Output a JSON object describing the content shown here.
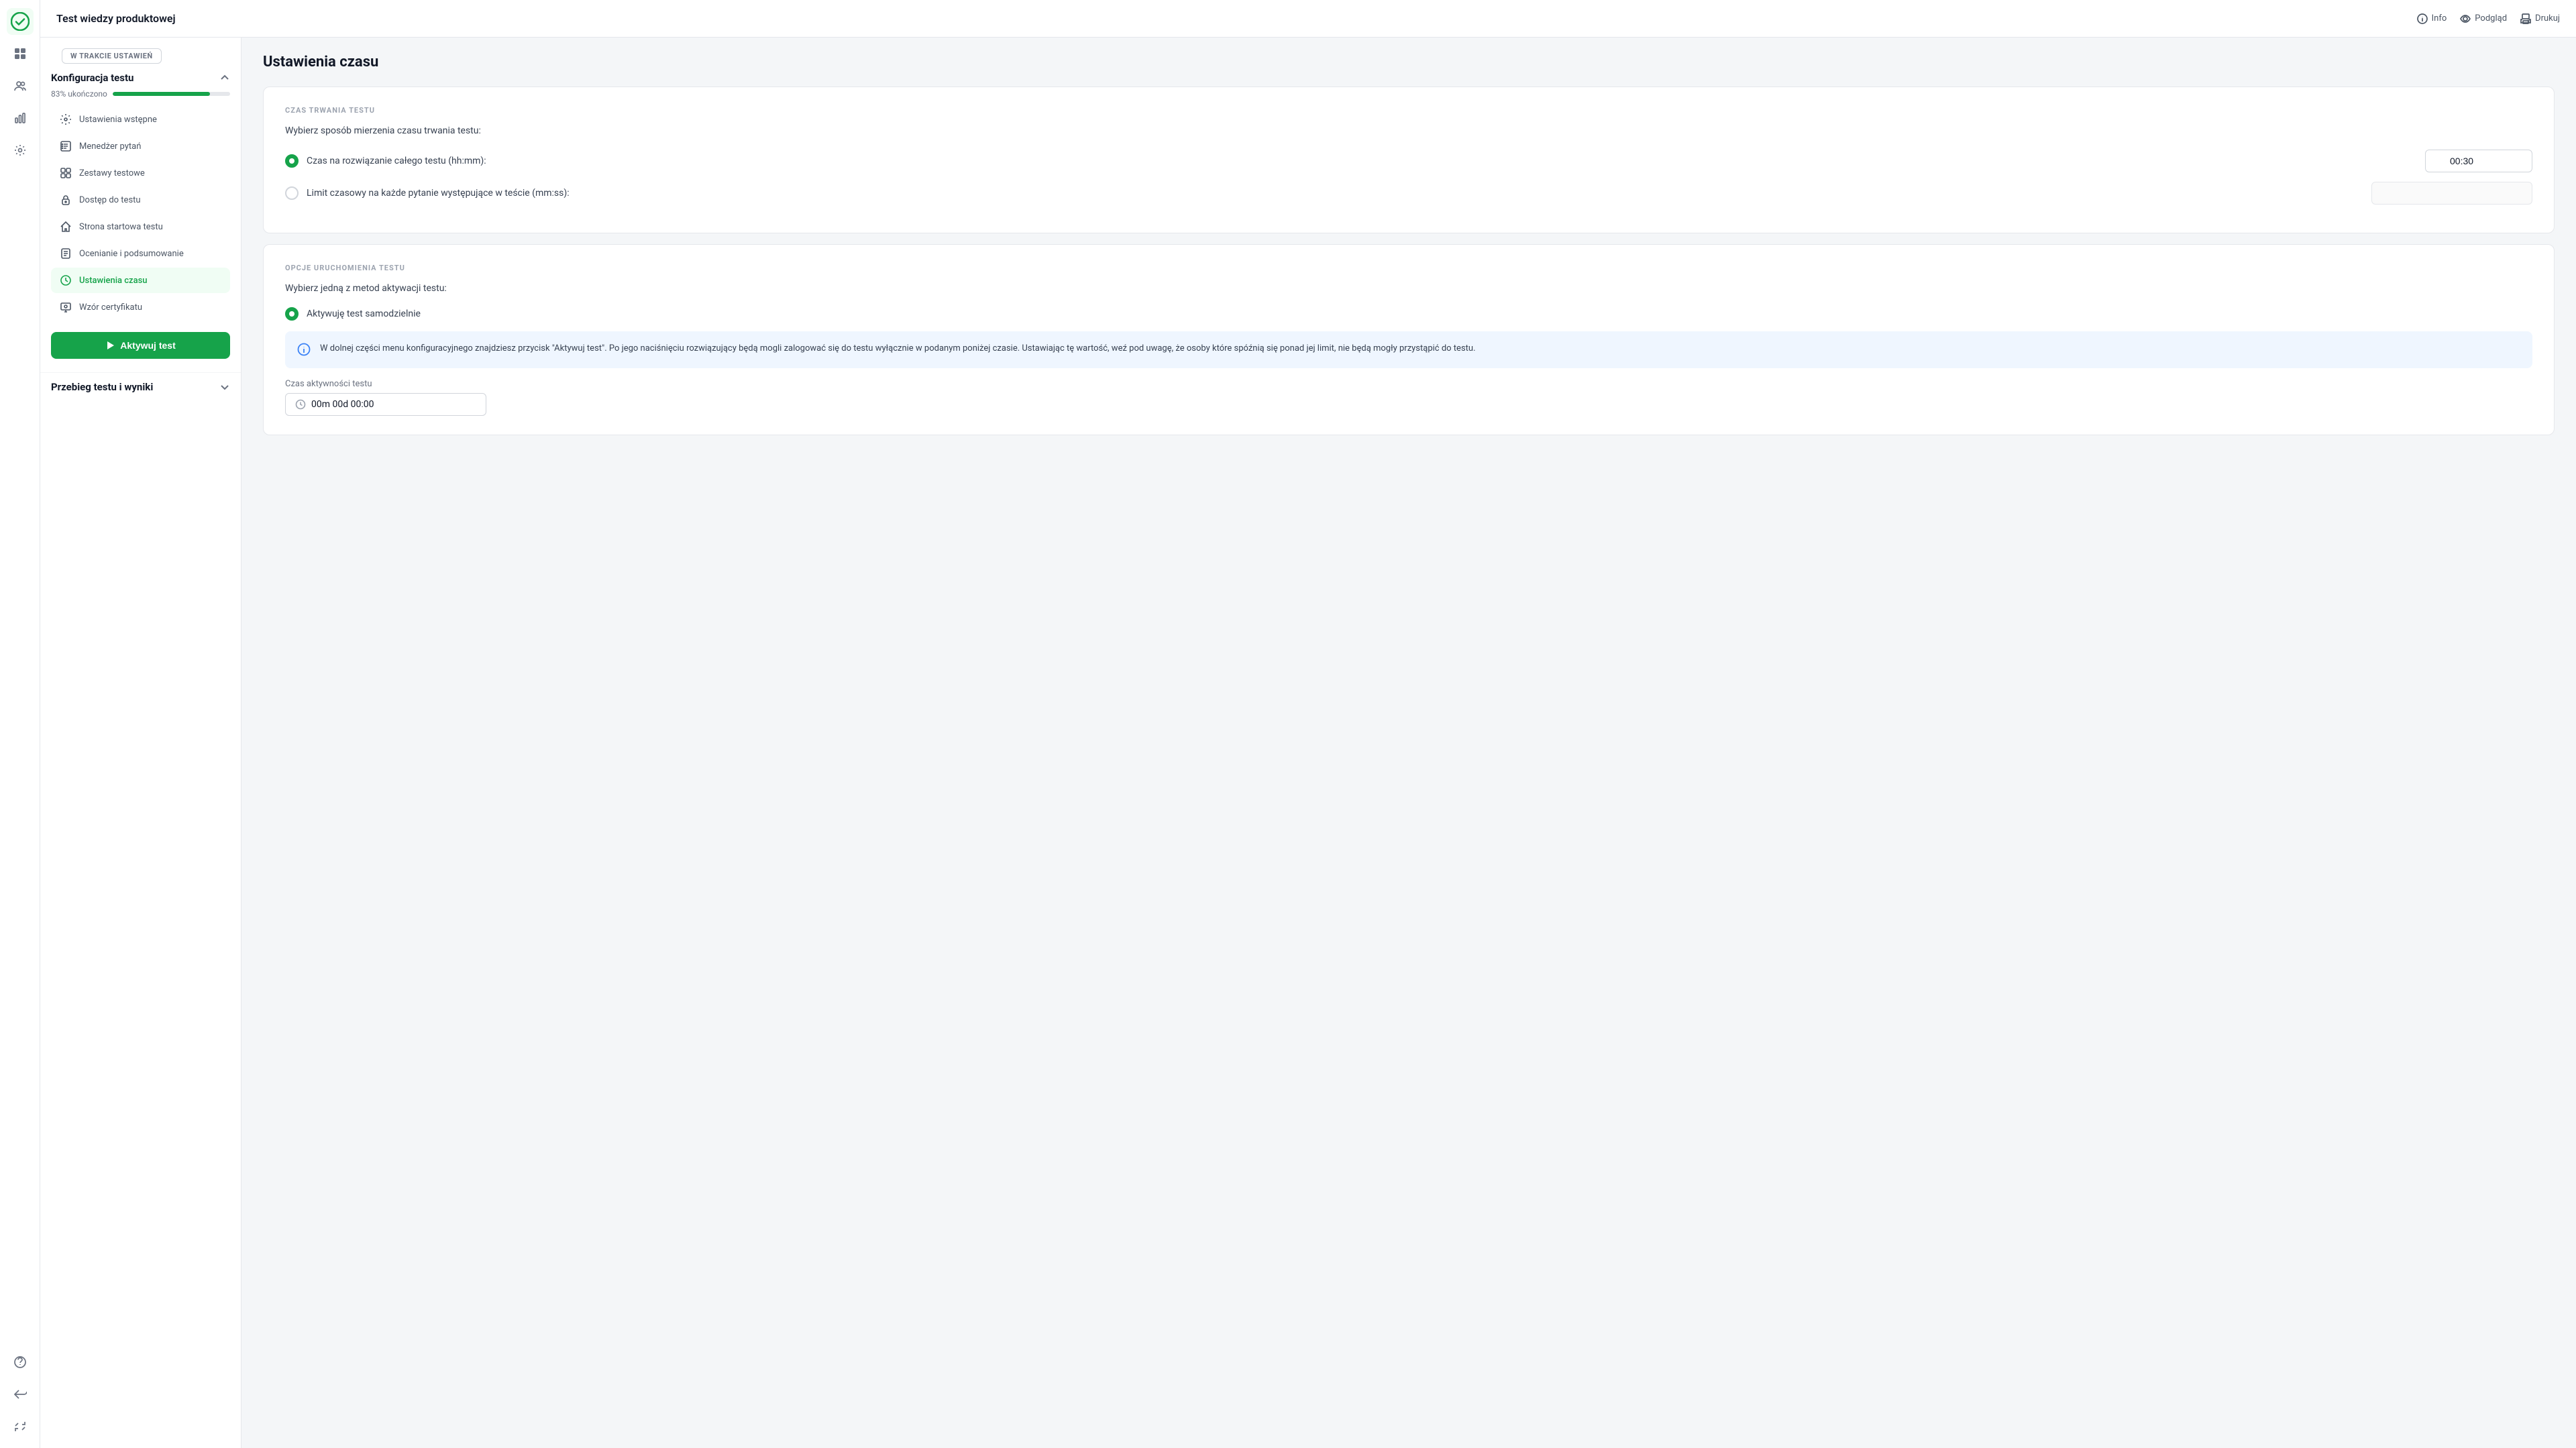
{
  "app": {
    "logo_alt": "App Logo"
  },
  "header": {
    "title": "Test wiedzy produktowej",
    "actions": {
      "info": "Info",
      "preview": "Podgląd",
      "print": "Drukuj"
    }
  },
  "sidebar": {
    "status_badge": "W TRAKCIE USTAWIEŃ",
    "config_section": {
      "title": "Konfiguracja testu",
      "progress_label": "83% ukończono",
      "progress_value": 83,
      "chevron": "up"
    },
    "nav_items": [
      {
        "id": "ustawienia-wstepne",
        "label": "Ustawienia wstępne",
        "icon": "settings-icon",
        "active": false
      },
      {
        "id": "menedzer-pytan",
        "label": "Menedżer pytań",
        "icon": "questions-icon",
        "active": false
      },
      {
        "id": "zestawy-testowe",
        "label": "Zestawy testowe",
        "icon": "sets-icon",
        "active": false
      },
      {
        "id": "dostep-do-testu",
        "label": "Dostęp do testu",
        "icon": "lock-icon",
        "active": false
      },
      {
        "id": "strona-startowa",
        "label": "Strona startowa testu",
        "icon": "home-icon",
        "active": false
      },
      {
        "id": "ocenianie",
        "label": "Ocenianie i podsumowanie",
        "icon": "assessment-icon",
        "active": false
      },
      {
        "id": "ustawienia-czasu",
        "label": "Ustawienia czasu",
        "icon": "time-icon",
        "active": true
      },
      {
        "id": "wzor-certyfikatu",
        "label": "Wzór certyfikatu",
        "icon": "certificate-icon",
        "active": false
      }
    ],
    "activate_btn": "Aktywuj test",
    "results_section": {
      "title": "Przebieg testu i wyniki",
      "chevron": "down"
    }
  },
  "content": {
    "page_title": "Ustawienia czasu",
    "section1": {
      "section_label": "CZAS TRWANIA TESTU",
      "description": "Wybierz sposób mierzenia czasu trwania testu:",
      "option1": {
        "label": "Czas na rozwiązanie całego testu (hh:mm):",
        "selected": true,
        "value": "00:30"
      },
      "option2": {
        "label": "Limit czasowy na każde pytanie występujące w teście (mm:ss):",
        "selected": false,
        "value": ""
      }
    },
    "section2": {
      "section_label": "OPCJE URUCHOMIENIA TESTU",
      "description": "Wybierz jedną z metod aktywacji testu:",
      "option1": {
        "label": "Aktywuję test samodzielnie",
        "selected": true
      },
      "info_box": "W dolnej części menu konfiguracyjnego znajdziesz przycisk \"Aktywuj test\". Po jego naciśnięciu rozwiązujący będą mogli zalogować się do testu wyłącznie w podanym poniżej czasie. Ustawiając tę wartość, weź pod uwagę, że osoby które spóźnią się ponad jej limit, nie będą mogły przystąpić do testu.",
      "activity_label": "Czas aktywności testu",
      "activity_value": "00m 00d 00:00"
    }
  },
  "icons": {
    "chevron_up": "▲",
    "chevron_down": "▼",
    "play": "▶",
    "info": "ℹ",
    "clock": "🕐"
  }
}
